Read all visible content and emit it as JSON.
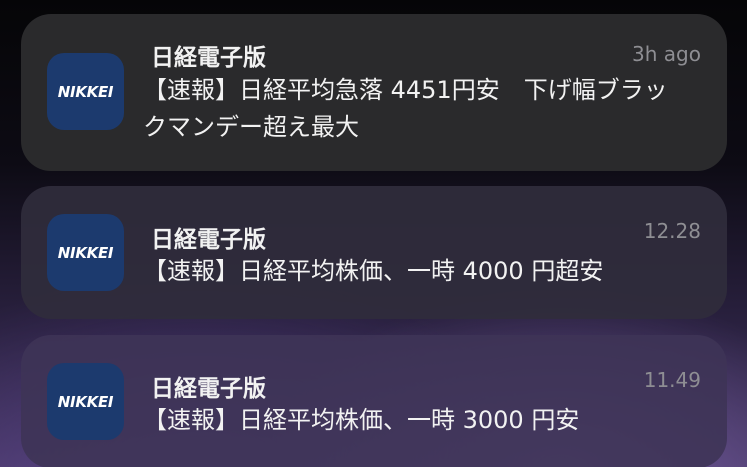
{
  "notifications": [
    {
      "icon_label": "NIKKEI",
      "app_name": "日経電子版",
      "time": "3h ago",
      "message": "【速報】日経平均急落 4451円安　下げ幅ブラックマンデー超え最大"
    },
    {
      "icon_label": "NIKKEI",
      "app_name": "日経電子版",
      "time": "12.28",
      "message": "【速報】日経平均株価、一時 4000 円超安"
    },
    {
      "icon_label": "NIKKEI",
      "app_name": "日経電子版",
      "time": "11.49",
      "message": "【速報】日経平均株価、一時 3000 円安"
    }
  ],
  "colors": {
    "icon_background": "#1c3a6e",
    "card_background": "#2a2a2c",
    "timestamp_text": "#8e8e93"
  }
}
